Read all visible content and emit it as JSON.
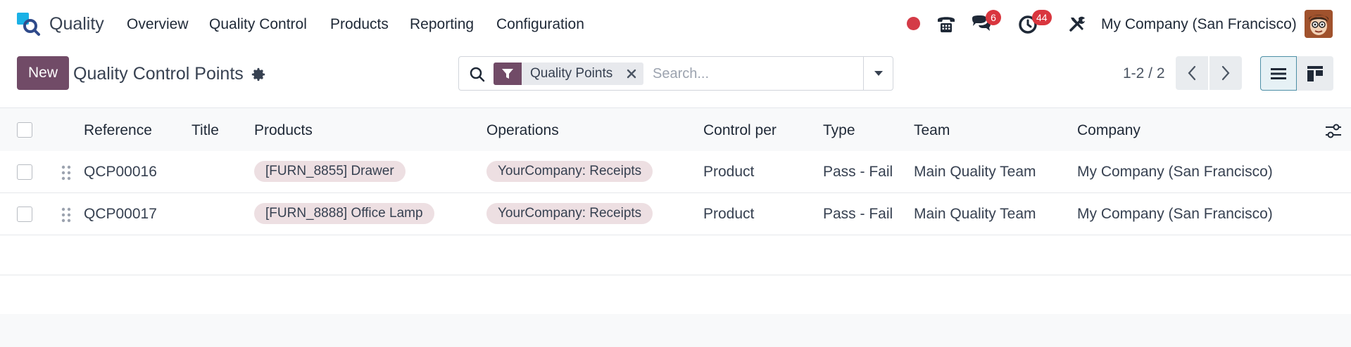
{
  "app": {
    "name": "Quality"
  },
  "nav": {
    "items": [
      "Overview",
      "Quality Control",
      "Products",
      "Reporting",
      "Configuration"
    ]
  },
  "systray": {
    "messages_count": "6",
    "activities_count": "44",
    "company": "My Company (San Francisco)"
  },
  "control_panel": {
    "new_label": "New",
    "title": "Quality Control Points",
    "facet_label": "Quality Points",
    "search_placeholder": "Search...",
    "pager": "1-2 / 2"
  },
  "table": {
    "columns": [
      "Reference",
      "Title",
      "Products",
      "Operations",
      "Control per",
      "Type",
      "Team",
      "Company"
    ],
    "rows": [
      {
        "reference": "QCP00016",
        "title": "",
        "product": "[FURN_8855] Drawer",
        "operation": "YourCompany: Receipts",
        "control_per": "Product",
        "type": "Pass - Fail",
        "team": "Main Quality Team",
        "company": "My Company (San Francisco)"
      },
      {
        "reference": "QCP00017",
        "title": "",
        "product": "[FURN_8888] Office Lamp",
        "operation": "YourCompany: Receipts",
        "control_per": "Product",
        "type": "Pass - Fail",
        "team": "Main Quality Team",
        "company": "My Company (San Francisco)"
      }
    ]
  },
  "colors": {
    "brand": "#714b67",
    "tag_bg": "#eddfe2",
    "badge": "#d9363e",
    "record_dot": "#d43b47"
  },
  "icons": {
    "app_logo": "quality-logo-icon",
    "record": "record-dot-icon",
    "phone": "phone-icon",
    "messages": "chat-icon",
    "activities": "clock-icon",
    "debug": "tools-icon",
    "gear": "gear-icon",
    "search": "search-icon",
    "filter": "filter-icon",
    "remove": "close-icon",
    "toggle": "caret-down-icon",
    "prev": "chevron-left-icon",
    "next": "chevron-right-icon",
    "list_view": "list-view-icon",
    "kanban_view": "kanban-view-icon",
    "optional_columns": "sliders-icon",
    "drag": "drag-handle-icon"
  }
}
